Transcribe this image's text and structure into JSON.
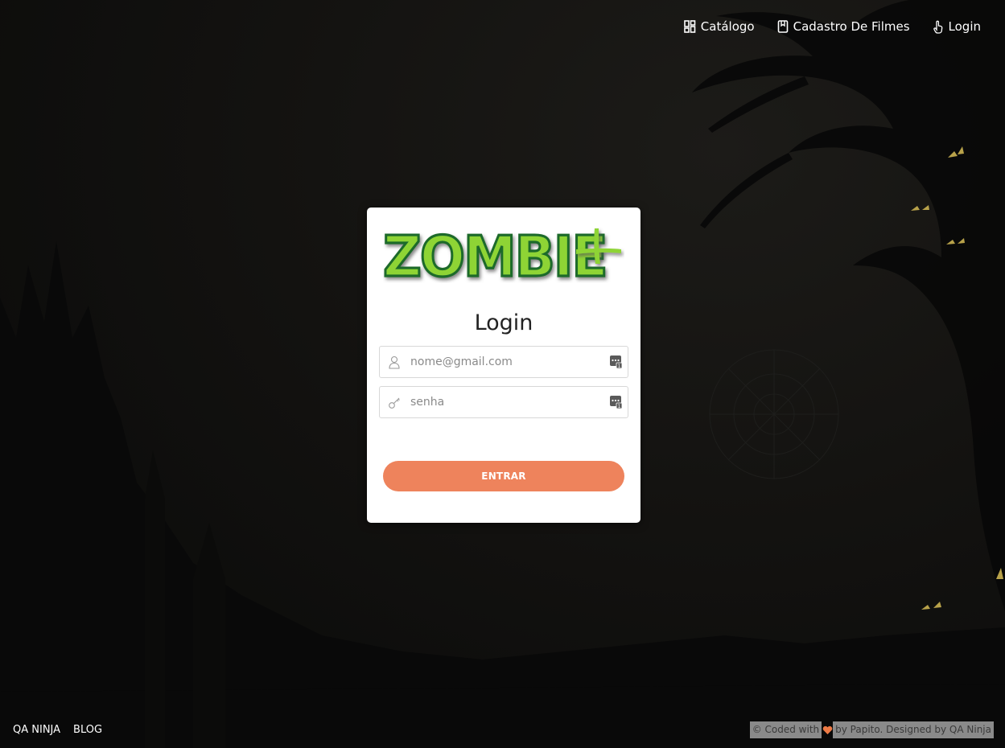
{
  "nav": {
    "items": [
      {
        "label": "Catálogo",
        "icon": "catalog-icon"
      },
      {
        "label": "Cadastro De Filmes",
        "icon": "bookmark-icon"
      },
      {
        "label": "Login",
        "icon": "pointer-hand-icon"
      }
    ]
  },
  "login": {
    "logo_text": "ZOMBIE+",
    "title": "Login",
    "email_placeholder": "nome@gmail.com",
    "password_placeholder": "senha",
    "submit_label": "ENTRAR"
  },
  "footer": {
    "links": [
      {
        "label": "QA NINJA"
      },
      {
        "label": "BLOG"
      }
    ],
    "credit_prefix": "© Coded with",
    "credit_suffix": "by Papito. Designed by QA Ninja"
  },
  "colors": {
    "accent": "#ee835c",
    "logo_green": "#8ed434",
    "background": "#0d0d0c"
  }
}
